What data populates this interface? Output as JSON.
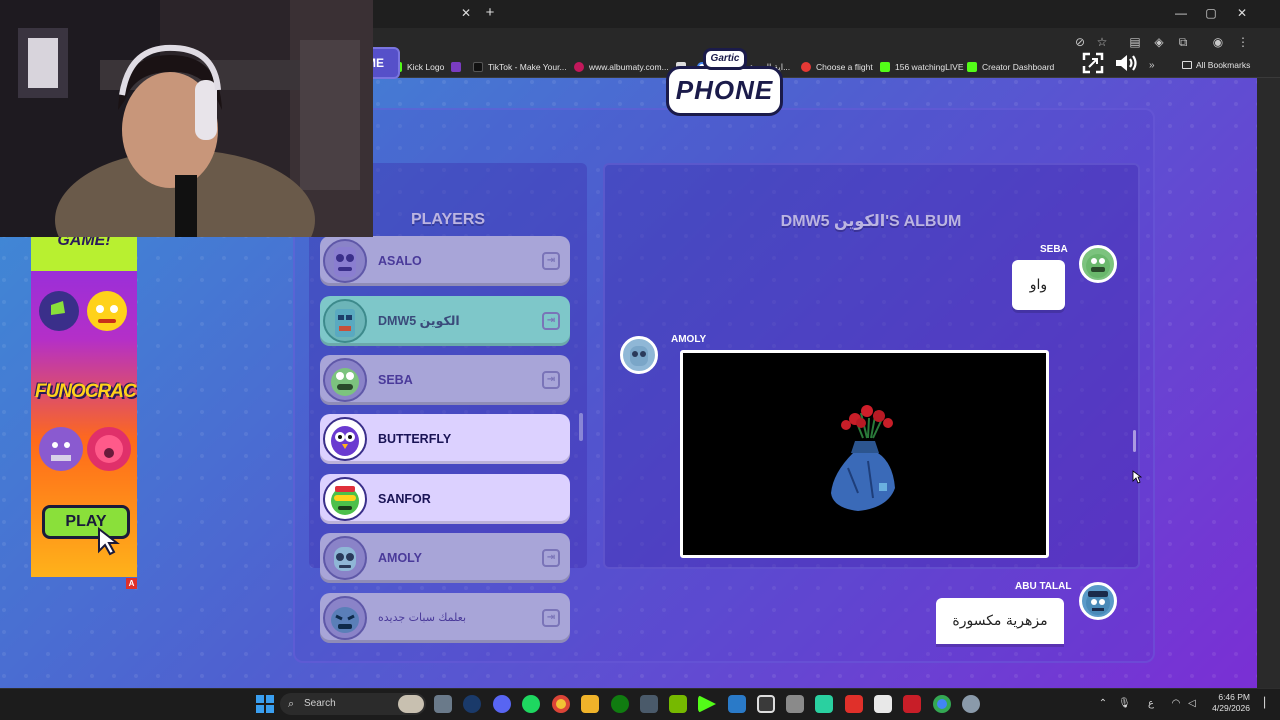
{
  "browser": {
    "tab_close_glyph": "✕",
    "new_tab_glyph": "+",
    "window_controls": [
      "—",
      "▢",
      "✕"
    ],
    "bookmarks": [
      {
        "label": "Kick Logo",
        "color": "#53fc18"
      },
      {
        "label": "TikTok - Make Your...",
        "color": "#111111"
      },
      {
        "label": "www.albumaty.com...",
        "color": "#c2185b"
      },
      {
        "label": "",
        "color": "#e0e0e0"
      },
      {
        "label": "اية المسؤولية - بحث...",
        "color": "#4285f4"
      },
      {
        "label": "Choose a flight",
        "color": "#e53935"
      },
      {
        "label": "156 watchingLIVE",
        "color": "#53fc18"
      },
      {
        "label": "Creator Dashboard",
        "color": "#53fc18"
      }
    ],
    "all_bookmarks": "All Bookmarks"
  },
  "game": {
    "home_button_label": "ME",
    "logo_top": "Gartic",
    "logo_main": "PHONE",
    "players_header": "PLAYERS",
    "album_header": "DMW5 الكوين'S ALBUM",
    "players": [
      {
        "name": "ASALO",
        "state": "normal",
        "avatar_color": "#9a8fd6"
      },
      {
        "name": "DMW5 الكوين",
        "state": "host",
        "avatar_color": "#7ac6c6"
      },
      {
        "name": "SEBA",
        "state": "normal",
        "avatar_color": "#88c88a"
      },
      {
        "name": "BUTTERFLY",
        "state": "active",
        "avatar_color": "#6a3ad0"
      },
      {
        "name": "SANFOR",
        "state": "active",
        "avatar_color": "#4cc04a"
      },
      {
        "name": "AMOLY",
        "state": "normal",
        "avatar_color": "#8fb7d6"
      },
      {
        "name": "بعلمك سبات جديده",
        "state": "normal",
        "avatar_color": "#5a7fb8"
      }
    ],
    "album": {
      "entry1_author": "SEBA",
      "entry1_text": "واو",
      "entry2_author": "AMOLY",
      "entry3_author": "ABU TALAL",
      "entry3_text": "مزهرية مكسورة"
    }
  },
  "ad": {
    "title": "GAME!",
    "brand": "FUNOCRACY",
    "play_label": "PLAY",
    "badge": "A"
  },
  "taskbar": {
    "search_label": "Search",
    "time": "6:46 PM",
    "date": "4/29/2026",
    "lang": "ع"
  }
}
